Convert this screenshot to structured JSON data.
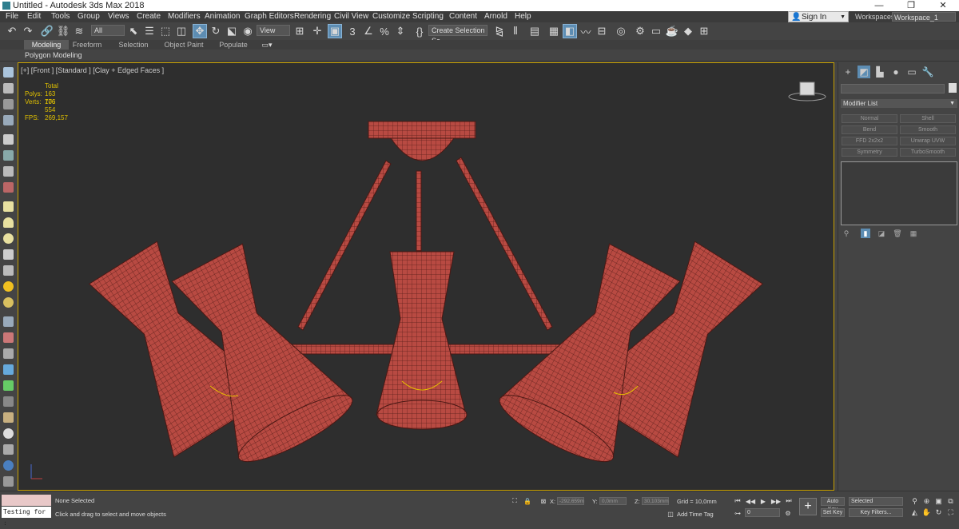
{
  "window": {
    "title": "Untitled - Autodesk 3ds Max 2018",
    "controls": [
      "—",
      "❐",
      "✕"
    ]
  },
  "menubar": {
    "items": [
      "File",
      "Edit",
      "Tools",
      "Group",
      "Views",
      "Create",
      "Modifiers",
      "Animation",
      "Graph Editors",
      "Rendering",
      "Civil View",
      "Customize",
      "Scripting",
      "Content",
      "Arnold",
      "Help"
    ],
    "sign_in": "Sign In",
    "workspaces_label": "Workspaces:",
    "workspace": "Workspace_1"
  },
  "toolbar": {
    "selection_filter": "All",
    "reference_coord": "View",
    "snap_label": "3",
    "named_selection": "Create Selection Se"
  },
  "ribbon": {
    "tabs": [
      "Modeling",
      "Freeform",
      "Selection",
      "Object Paint",
      "Populate"
    ],
    "active_tab": "Modeling",
    "panel_label": "Polygon Modeling"
  },
  "viewport": {
    "label": "[+] [Front ] [Standard ] [Clay + Edged Faces ]",
    "stats": {
      "total_label": "Total",
      "polys_label": "Polys:",
      "polys_value": "163 776",
      "verts_label": "Verts:",
      "verts_value": "106 554",
      "fps_label": "FPS:",
      "fps_value": "269,157"
    },
    "mesh_color": "#b84a42",
    "background": "#2e2e2e"
  },
  "command_panel": {
    "modifier_list_label": "Modifier List",
    "modifier_buttons": [
      "Normal",
      "Shell",
      "Bend",
      "Smooth",
      "FFD 2x2x2",
      "Unwrap UVW",
      "Symmetry",
      "TurboSmooth"
    ]
  },
  "status": {
    "maxscript_output": "Testing for :",
    "selection": "None Selected",
    "prompt": "Click and drag to select and move objects",
    "x_label": "X:",
    "x_value": "-292,659m",
    "y_label": "Y:",
    "y_value": "0,0mm",
    "z_label": "Z:",
    "z_value": "30,103mm",
    "grid": "Grid = 10,0mm",
    "add_time_tag": "Add Time Tag",
    "frame": "0",
    "auto_key": "Auto Key",
    "set_key": "Set Key",
    "key_mode": "Selected",
    "key_filters": "Key Filters..."
  }
}
